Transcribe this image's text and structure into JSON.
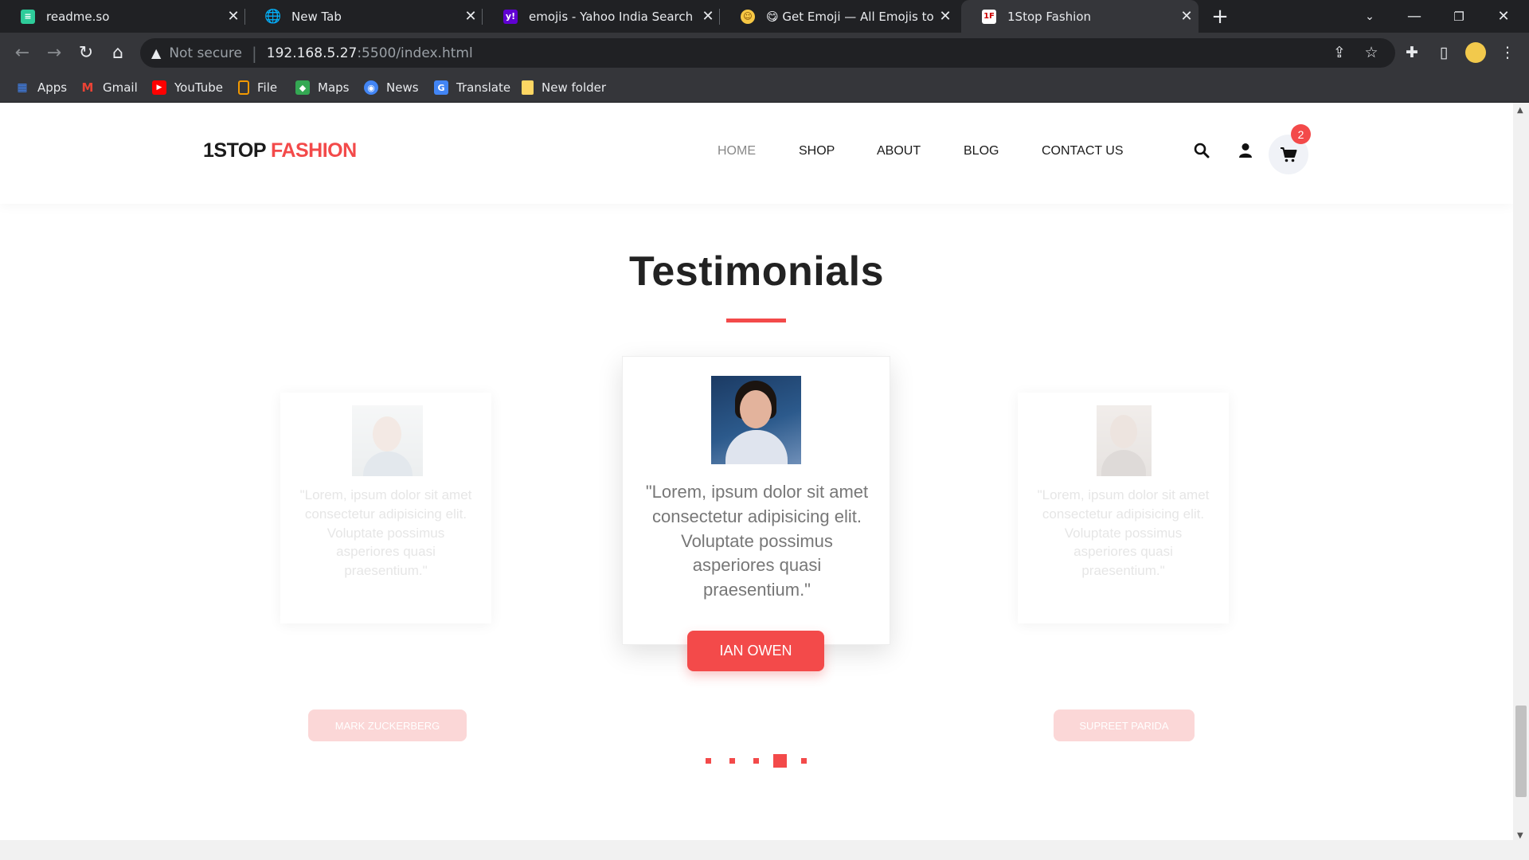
{
  "browser": {
    "tabs": [
      {
        "title": "readme.so",
        "favicon": "readme-icon",
        "active": false
      },
      {
        "title": "New Tab",
        "favicon": "globe-icon",
        "active": false
      },
      {
        "title": "emojis - Yahoo India Search Resu",
        "favicon": "yahoo-icon",
        "active": false
      },
      {
        "title": "😋 Get Emoji — All Emojis to ✂️",
        "favicon": "emoji-icon",
        "active": false
      },
      {
        "title": "1Stop Fashion",
        "favicon": "1f-icon",
        "active": true
      }
    ],
    "address": {
      "security": "Not secure",
      "host": "192.168.5.27",
      "path": ":5500/index.html"
    },
    "bookmarks": [
      {
        "label": "Apps",
        "icon": "apps-grid-icon"
      },
      {
        "label": "Gmail",
        "icon": "gmail-icon"
      },
      {
        "label": "YouTube",
        "icon": "youtube-icon"
      },
      {
        "label": "File",
        "icon": "file-icon"
      },
      {
        "label": "Maps",
        "icon": "maps-icon"
      },
      {
        "label": "News",
        "icon": "news-icon"
      },
      {
        "label": "Translate",
        "icon": "translate-icon"
      },
      {
        "label": "New folder",
        "icon": "folder-icon"
      }
    ]
  },
  "site": {
    "logo": {
      "part1": "1STOP",
      "part2": "FASHION"
    },
    "nav": [
      {
        "label": "HOME",
        "active": true
      },
      {
        "label": "SHOP",
        "active": false
      },
      {
        "label": "ABOUT",
        "active": false
      },
      {
        "label": "BLOG",
        "active": false
      },
      {
        "label": "CONTACT US",
        "active": false
      }
    ],
    "cart_count": "2"
  },
  "testimonials": {
    "title": "Testimonials",
    "cards": [
      {
        "quote": "\"Lorem, ipsum dolor sit amet consectetur adipisicing elit. Voluptate possimus asperiores quasi praesentium.\"",
        "name": "MARK ZUCKERBERG",
        "state": "faded"
      },
      {
        "quote": "\"Lorem, ipsum dolor sit amet consectetur adipisicing elit. Voluptate possimus asperiores quasi praesentium.\"",
        "name": "IAN OWEN",
        "state": "active"
      },
      {
        "quote": "\"Lorem, ipsum dolor sit amet consectetur adipisicing elit. Voluptate possimus asperiores quasi praesentium.\"",
        "name": "SUPREET PARIDA",
        "state": "faded"
      }
    ],
    "pagination": {
      "count": 5,
      "active_index": 3
    }
  },
  "colors": {
    "accent": "#f34a4a",
    "chrome_dark": "#202124",
    "chrome_toolbar": "#35363a"
  }
}
